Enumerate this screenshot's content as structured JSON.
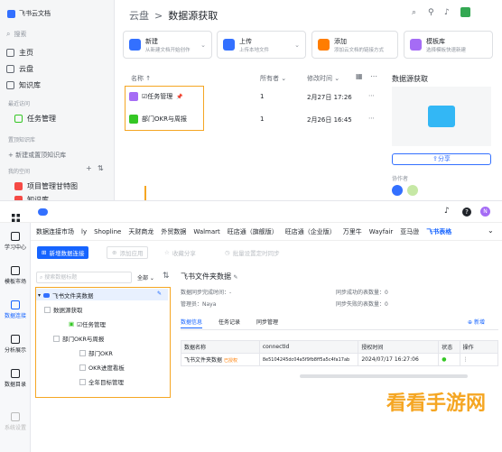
{
  "top": {
    "brand": "飞书云文档",
    "sidebar": {
      "search": "搜索",
      "items": [
        {
          "label": "主页",
          "icon": "home-icon"
        },
        {
          "label": "云盘",
          "icon": "cloud-drive-icon"
        },
        {
          "label": "知识库",
          "icon": "wiki-icon"
        }
      ],
      "recent_title": "最近访问",
      "recent_item": "任务管理",
      "wiki_title": "置顶知识库",
      "new_wiki": "+ 新建或置顶知识库",
      "my_space": "我的空间",
      "project_item": "项目管理甘特图",
      "cut_item": "知识库…"
    },
    "breadcrumb": {
      "root": "云盘",
      "sep": ">",
      "current": "数据源获取"
    },
    "actions": [
      {
        "t1": "新建",
        "t2": "从新建文档开始创作",
        "color": "#3370ff"
      },
      {
        "t1": "上传",
        "t2": "上传本地文件",
        "color": "#3370ff"
      },
      {
        "t1": "添加",
        "t2": "添加云文档的链接方式",
        "color": "#ff7d00"
      },
      {
        "t1": "模板库",
        "t2": "选择模板快速新建",
        "color": "#a56cf5"
      }
    ],
    "columns": {
      "name": "名称 ↑",
      "owner": "所有者 ⌄",
      "modified": "修改时间 ⌄"
    },
    "rows": [
      {
        "name": "☑任务管理",
        "pin": "📌",
        "owner": "1",
        "modified": "2月27日 17:26",
        "color": "#a56cf5"
      },
      {
        "name": "部门OKR与周报",
        "owner": "1",
        "modified": "2月26日 16:45",
        "color": "#34c724"
      }
    ],
    "panel": {
      "title": "数据源获取",
      "share": "分享",
      "collab": "协作者"
    }
  },
  "bot": {
    "header_icons": [
      "bell-icon",
      "help-icon",
      "avatar-icon"
    ],
    "avatar_text": "N",
    "rail": [
      {
        "label": "学习中心"
      },
      {
        "label": "模板市场"
      },
      {
        "label": "数据连接",
        "active": true
      },
      {
        "label": "分析展示"
      },
      {
        "label": "数据目录"
      },
      {
        "label": "系统设置"
      }
    ],
    "tabs": [
      "数据连接市场",
      "ly",
      "Shopline",
      "天财商龙",
      "外贸数据",
      "Walmart",
      "旺店通（旗舰版）",
      "旺店通（企业版）",
      "万里牛",
      "Wayfair",
      "亚马逊",
      "飞书表格"
    ],
    "active_tab": 11,
    "buttons": {
      "new": "新增数据连接",
      "add_app": "添加应用",
      "collect": "收藏分享",
      "batch": "批量设置定时同步"
    },
    "search_placeholder": "搜索数据标题",
    "filter": "全部",
    "tree": {
      "root": "飞书文件夹数据",
      "folder": "数据源获取",
      "items": [
        "☑任务管理",
        "部门OKR与周报",
        "部门OKR",
        "OKR进度看板",
        "全年目标管理"
      ]
    },
    "detail": {
      "title": "飞书文件夹数据",
      "sync_done": "数据同步完成时间：-",
      "manager": "管理员：Naya",
      "sync_count": "同步成功的表数量：0",
      "sync_fail": "同步失败的表数量：0",
      "tabs": [
        "数据信息",
        "任务记录",
        "同步管理"
      ],
      "new_btn": "新增",
      "cols": [
        "数据名称",
        "connectId",
        "授权时间",
        "状态",
        "操作"
      ],
      "row": {
        "name": "飞书文件夹数据",
        "tag": "已授权",
        "id": "8e5104245dc04a5f9fb8ff5a5c4fa17ab",
        "time": "2024/07/17 16:27:06",
        "status": "●"
      }
    }
  },
  "watermark": "看看手游网"
}
